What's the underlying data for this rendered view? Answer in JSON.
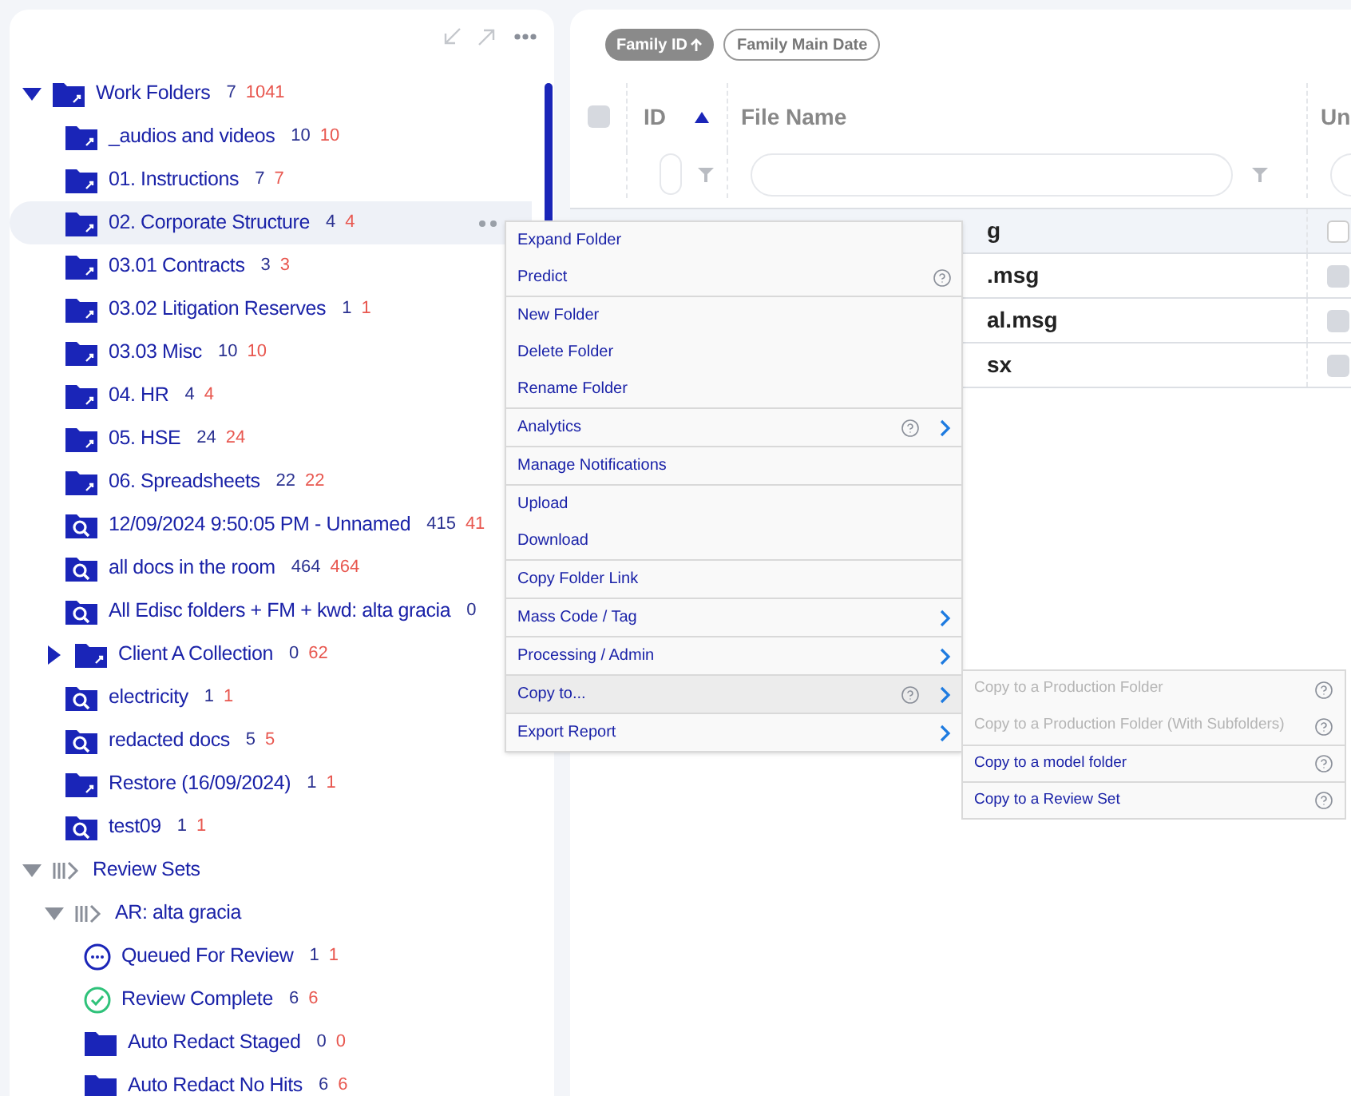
{
  "tree": [
    {
      "label": "Work Folders",
      "kind": "folder",
      "expanded": true,
      "count": "7",
      "count_total": "1041",
      "children": [
        {
          "label": "_audios and videos",
          "kind": "folder",
          "count": "10",
          "count_total": "10"
        },
        {
          "label": "01. Instructions",
          "kind": "folder",
          "count": "7",
          "count_total": "7"
        },
        {
          "label": "02. Corporate Structure",
          "kind": "folder",
          "count": "4",
          "count_total": "4",
          "highlighted": true
        },
        {
          "label": "03.01 Contracts",
          "kind": "folder",
          "count": "3",
          "count_total": "3"
        },
        {
          "label": "03.02 Litigation Reserves",
          "kind": "folder",
          "count": "1",
          "count_total": "1"
        },
        {
          "label": "03.03 Misc",
          "kind": "folder",
          "count": "10",
          "count_total": "10"
        },
        {
          "label": "04. HR",
          "kind": "folder",
          "count": "4",
          "count_total": "4"
        },
        {
          "label": "05. HSE",
          "kind": "folder",
          "count": "24",
          "count_total": "24"
        },
        {
          "label": "06. Spreadsheets",
          "kind": "folder",
          "count": "22",
          "count_total": "22"
        },
        {
          "label": "12/09/2024 9:50:05 PM - Unnamed",
          "kind": "search",
          "count": "415",
          "count_total": "41"
        },
        {
          "label": "all docs in the room",
          "kind": "search",
          "count": "464",
          "count_total": "464"
        },
        {
          "label": "All Edisc folders + FM + kwd: alta gracia",
          "kind": "search",
          "count": "0"
        },
        {
          "label": "Client A Collection",
          "kind": "folder",
          "expanded": false,
          "count": "0",
          "count_total": "62"
        },
        {
          "label": "electricity",
          "kind": "search",
          "count": "1",
          "count_total": "1"
        },
        {
          "label": "redacted docs",
          "kind": "search",
          "count": "5",
          "count_total": "5"
        },
        {
          "label": "Restore (16/09/2024)",
          "kind": "folder",
          "count": "1",
          "count_total": "1"
        },
        {
          "label": "test09",
          "kind": "search",
          "count": "1",
          "count_total": "1"
        }
      ]
    },
    {
      "label": "Review Sets",
      "kind": "reviewset",
      "expanded": true,
      "children": [
        {
          "label": "AR: alta gracia",
          "kind": "reviewset",
          "expanded": true,
          "children": [
            {
              "label": "Queued For Review",
              "kind": "queued",
              "count": "1",
              "count_total": "1"
            },
            {
              "label": "Review Complete",
              "kind": "complete",
              "count": "6",
              "count_total": "6"
            },
            {
              "label": "Auto Redact Staged",
              "kind": "plainfolder",
              "count": "0",
              "count_total": "0"
            },
            {
              "label": "Auto Redact No Hits",
              "kind": "plainfolder",
              "count": "6",
              "count_total": "6"
            }
          ]
        }
      ]
    }
  ],
  "sort_chips": [
    {
      "label": "Family ID",
      "selected": true
    },
    {
      "label": "Family Main Date",
      "selected": false
    }
  ],
  "table": {
    "columns": [
      "ID",
      "File Name",
      "Un"
    ],
    "select_all_checked": false,
    "rows": [
      {
        "file_name": "g",
        "highlighted": true
      },
      {
        "file_name": ".msg",
        "highlighted": false
      },
      {
        "file_name": "al.msg",
        "highlighted": false
      },
      {
        "file_name": "sx",
        "highlighted": false
      }
    ]
  },
  "context_menu": [
    [
      {
        "label": "Expand Folder",
        "help": false,
        "submenu": false,
        "selected": false
      },
      {
        "label": "Predict",
        "help": true,
        "submenu": false,
        "selected": false
      }
    ],
    [
      {
        "label": "New Folder",
        "help": false,
        "submenu": false,
        "selected": false
      },
      {
        "label": "Delete Folder",
        "help": false,
        "submenu": false,
        "selected": false
      },
      {
        "label": "Rename Folder",
        "help": false,
        "submenu": false,
        "selected": false
      }
    ],
    [
      {
        "label": "Analytics",
        "help": true,
        "submenu": true,
        "selected": false
      }
    ],
    [
      {
        "label": "Manage Notifications",
        "help": false,
        "submenu": false,
        "selected": false
      }
    ],
    [
      {
        "label": "Upload",
        "help": false,
        "submenu": false,
        "selected": false
      },
      {
        "label": "Download",
        "help": false,
        "submenu": false,
        "selected": false
      }
    ],
    [
      {
        "label": "Copy Folder Link",
        "help": false,
        "submenu": false,
        "selected": false
      }
    ],
    [
      {
        "label": "Mass Code / Tag",
        "help": false,
        "submenu": true,
        "selected": false
      }
    ],
    [
      {
        "label": "Processing / Admin",
        "help": false,
        "submenu": true,
        "selected": false
      }
    ],
    [
      {
        "label": "Copy to...",
        "help": true,
        "submenu": true,
        "selected": true
      }
    ],
    [
      {
        "label": "Export Report",
        "help": false,
        "submenu": true,
        "selected": false
      }
    ]
  ],
  "submenu": [
    {
      "label": "Copy to a Production Folder",
      "disabled": true
    },
    {
      "label": "Copy to a Production Folder (With Subfolders)",
      "disabled": true
    },
    {
      "label": "Copy to a model folder",
      "disabled": false
    },
    {
      "label": "Copy to a Review Set",
      "disabled": false
    }
  ]
}
